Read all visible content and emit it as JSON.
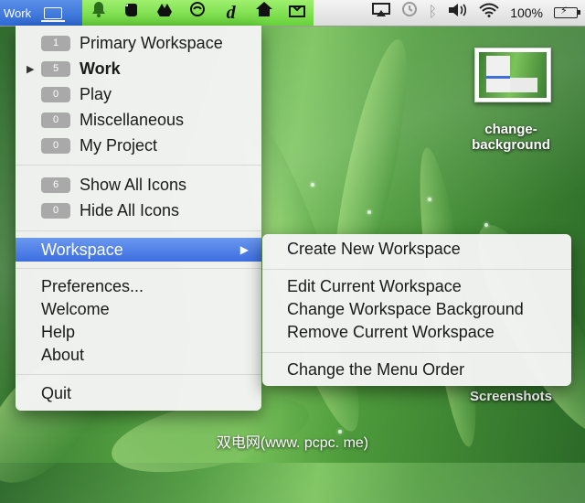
{
  "menubar": {
    "app_label": "Work",
    "app_icon": "laptop-icon",
    "battery_text": "100%"
  },
  "main_menu": {
    "workspaces": [
      {
        "count": "1",
        "label": "Primary Workspace"
      },
      {
        "count": "5",
        "label": "Work",
        "current": true
      },
      {
        "count": "0",
        "label": "Play"
      },
      {
        "count": "0",
        "label": "Miscellaneous"
      },
      {
        "count": "0",
        "label": "My Project"
      }
    ],
    "icon_actions": [
      {
        "count": "6",
        "label": "Show All Icons"
      },
      {
        "count": "0",
        "label": "Hide All Icons"
      }
    ],
    "workspace_label": "Workspace",
    "other_items": [
      "Preferences...",
      "Welcome",
      "Help",
      "About"
    ],
    "quit_label": "Quit"
  },
  "submenu": {
    "create": "Create New Workspace",
    "edit": "Edit Current Workspace",
    "change_bg": "Change Workspace Background",
    "remove": "Remove Current Workspace",
    "order": "Change the Menu Order"
  },
  "desktop": {
    "file_label_1": "change-",
    "file_label_2": "background",
    "folder_label": "Screenshots"
  },
  "watermark": "双电网(www. pcpc. me)",
  "colors": {
    "highlight": "#3d6ee0",
    "menubar_green": "#7ee04e"
  }
}
